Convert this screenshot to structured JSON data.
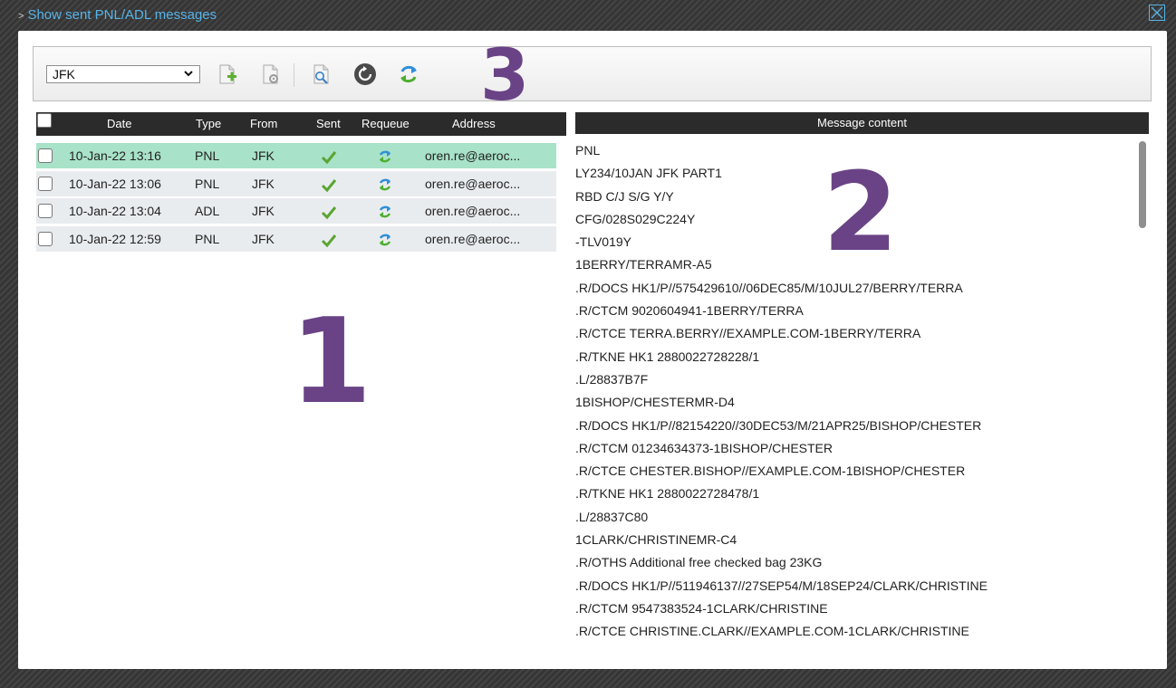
{
  "window": {
    "caret": ">",
    "title": "Show sent PNL/ADL messages"
  },
  "callouts": {
    "one": "1",
    "two": "2",
    "three": "3"
  },
  "toolbar": {
    "station_value": "JFK",
    "icons": [
      "new-message-icon",
      "create-settings-icon",
      "search-icon",
      "refresh-icon",
      "requeue-icon"
    ]
  },
  "list": {
    "headers": {
      "date": "Date",
      "type": "Type",
      "from": "From",
      "sent": "Sent",
      "requeue": "Requeue",
      "address": "Address"
    },
    "rows": [
      {
        "date": "10-Jan-22 13:16",
        "type": "PNL",
        "from": "JFK",
        "address": "oren.re@aeroc...",
        "selected": true
      },
      {
        "date": "10-Jan-22 13:06",
        "type": "PNL",
        "from": "JFK",
        "address": "oren.re@aeroc...",
        "selected": false
      },
      {
        "date": "10-Jan-22 13:04",
        "type": "ADL",
        "from": "JFK",
        "address": "oren.re@aeroc...",
        "selected": false
      },
      {
        "date": "10-Jan-22 12:59",
        "type": "PNL",
        "from": "JFK",
        "address": "oren.re@aeroc...",
        "selected": false
      }
    ]
  },
  "content": {
    "header": "Message content",
    "lines": [
      "PNL",
      "LY234/10JAN JFK PART1",
      "RBD C/J S/G Y/Y",
      "CFG/028S029C224Y",
      "-TLV019Y",
      "1BERRY/TERRAMR-A5",
      ".R/DOCS HK1/P//575429610//06DEC85/M/10JUL27/BERRY/TERRA",
      ".R/CTCM 9020604941-1BERRY/TERRA",
      ".R/CTCE TERRA.BERRY//EXAMPLE.COM-1BERRY/TERRA",
      ".R/TKNE HK1 2880022728228/1",
      ".L/28837B7F",
      "1BISHOP/CHESTERMR-D4",
      ".R/DOCS HK1/P//82154220//30DEC53/M/21APR25/BISHOP/CHESTER",
      ".R/CTCM 01234634373-1BISHOP/CHESTER",
      ".R/CTCE CHESTER.BISHOP//EXAMPLE.COM-1BISHOP/CHESTER",
      ".R/TKNE HK1 2880022728478/1",
      ".L/28837C80",
      "1CLARK/CHRISTINEMR-C4",
      ".R/OTHS Additional free checked bag 23KG",
      ".R/DOCS HK1/P//511946137//27SEP54/M/18SEP24/CLARK/CHRISTINE",
      ".R/CTCM 9547383524-1CLARK/CHRISTINE",
      ".R/CTCE CHRISTINE.CLARK//EXAMPLE.COM-1CLARK/CHRISTINE"
    ]
  },
  "colors": {
    "title_link": "#56b4e9",
    "header_bg": "#2b2b2b",
    "selected_row": "#a8e2c8",
    "row_bg": "#e9ecef",
    "callout": "#6a4386"
  }
}
